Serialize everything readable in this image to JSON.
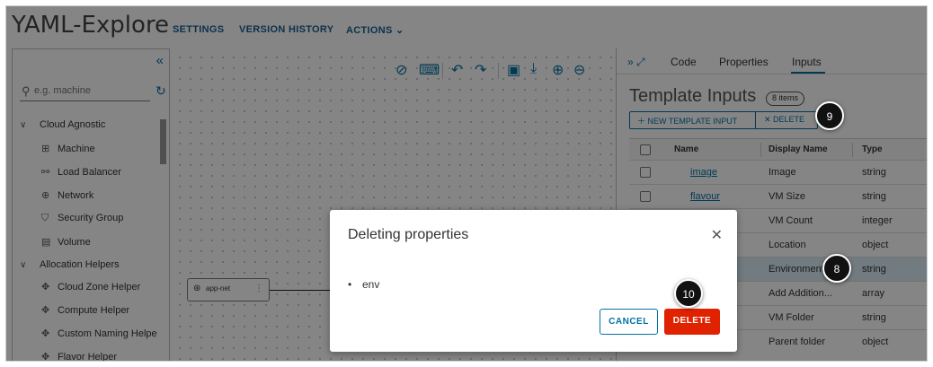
{
  "header": {
    "app_title": "YAML-Explore",
    "nav": [
      "SETTINGS",
      "VERSION HISTORY",
      "ACTIONS"
    ]
  },
  "sidebar": {
    "search": {
      "placeholder": "e.g. machine"
    },
    "categories": [
      {
        "label": "Cloud Agnostic",
        "items": [
          "Machine",
          "Load Balancer",
          "Network",
          "Security Group",
          "Volume"
        ]
      },
      {
        "label": "Allocation Helpers",
        "items": [
          "Cloud Zone Helper",
          "Compute Helper",
          "Custom Naming Helpe",
          "Flavor Helper"
        ]
      }
    ]
  },
  "canvas": {
    "node_label": "app-net"
  },
  "panel": {
    "tabs": [
      "Code",
      "Properties",
      "Inputs"
    ],
    "active_tab": "Inputs",
    "title": "Template Inputs",
    "badge": "8 items",
    "new_button": "NEW TEMPLATE INPUT",
    "delete_button": "DELETE",
    "columns": [
      "Name",
      "Display Name",
      "Type"
    ],
    "rows": [
      {
        "name": "image",
        "display": "Image",
        "type": "string"
      },
      {
        "name": "flavour",
        "display": "VM Size",
        "type": "string"
      },
      {
        "name": "",
        "display": "VM Count",
        "type": "integer"
      },
      {
        "name": "",
        "display": "Location",
        "type": "object"
      },
      {
        "name": "",
        "display": "Environment",
        "type": "string"
      },
      {
        "name": "",
        "display": "Add Addition...",
        "type": "array"
      },
      {
        "name": "",
        "display": "VM Folder",
        "type": "string"
      },
      {
        "name": "",
        "display": "Parent folder",
        "type": "object"
      }
    ]
  },
  "modal": {
    "title": "Deleting properties",
    "items": [
      "env"
    ],
    "cancel": "CANCEL",
    "confirm": "DELETE"
  },
  "steps": [
    "8",
    "9",
    "10"
  ],
  "colors": {
    "accent": "#0072a3",
    "danger": "#e12200",
    "selected_row": "#d9ecf6"
  }
}
